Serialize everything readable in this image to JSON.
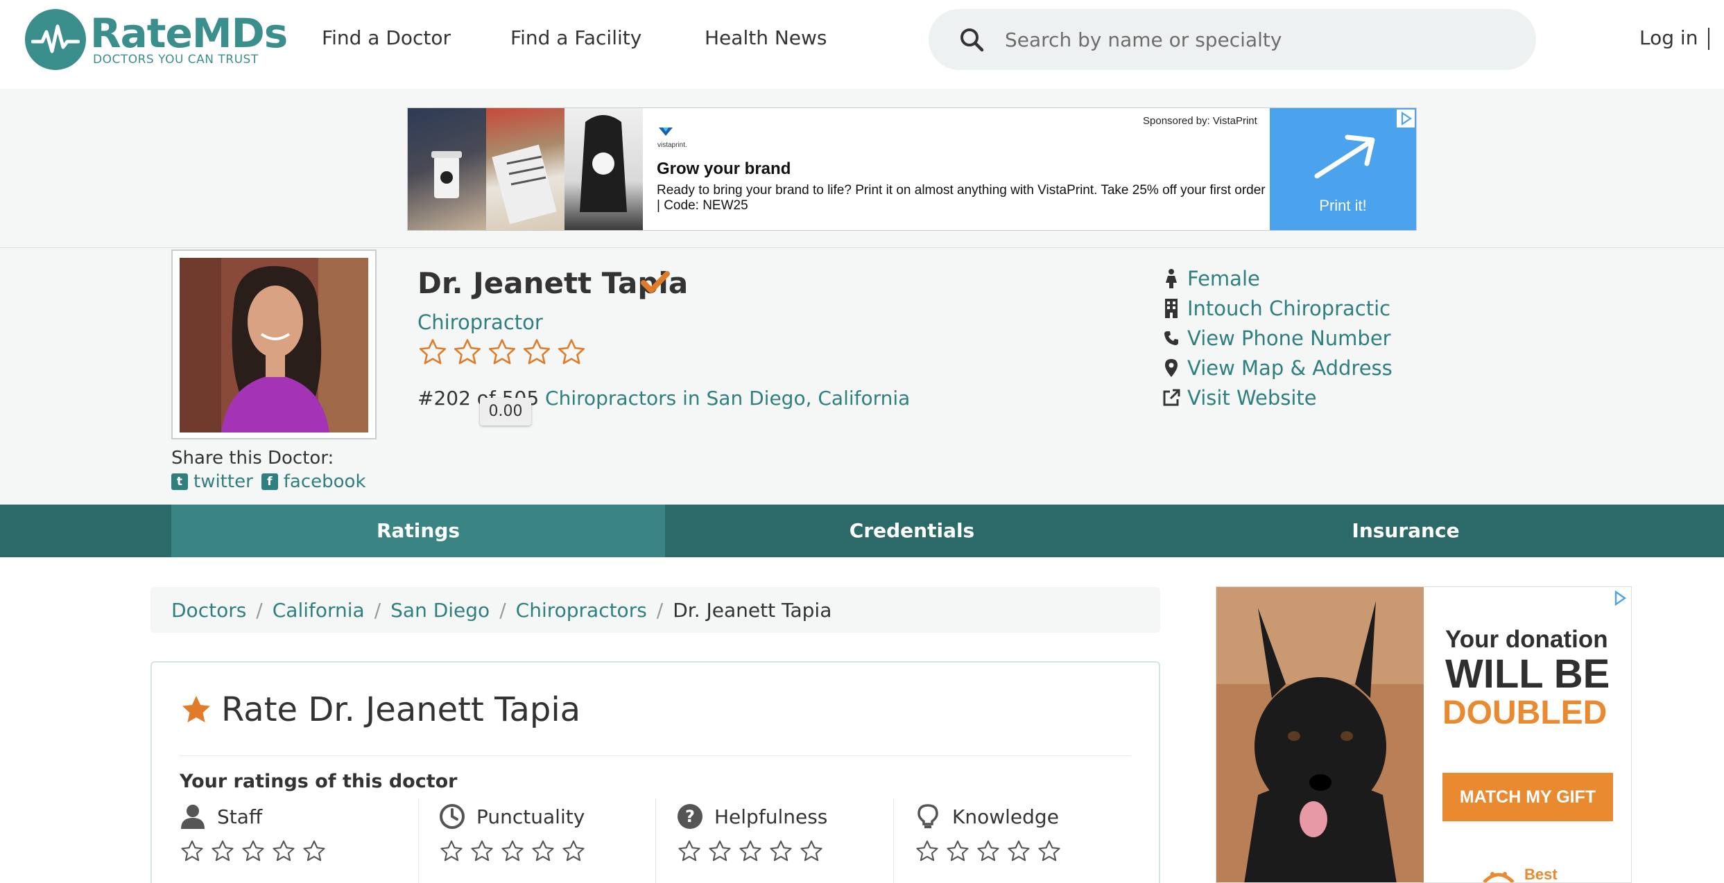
{
  "header": {
    "logo_name": "RateMDs",
    "logo_tagline": "DOCTORS YOU CAN TRUST",
    "nav": [
      "Find a Doctor",
      "Find a Facility",
      "Health News"
    ],
    "search_placeholder": "Search by name or specialty",
    "login": "Log in"
  },
  "top_ad": {
    "sponsor": "Sponsored by: VistaPrint",
    "brand_small": "vistaprint.",
    "title": "Grow your brand",
    "description": "Ready to bring your brand to life? Print it on almost anything with VistaPrint. Take 25% off your first order | Code: NEW25",
    "cta": "Print it!",
    "cta_color": "#4aa3ec"
  },
  "doctor": {
    "name": "Dr. Jeanett Tapia",
    "specialty": "Chiropractor",
    "rating": 0.0,
    "rating_tooltip": "0.00",
    "rank_prefix": "#202 of 505",
    "rank_link": "Chiropractors in San Diego, California",
    "share_label": "Share this Doctor:",
    "share_twitter": "twitter",
    "share_facebook": "facebook",
    "info": [
      {
        "icon": "female-icon",
        "label": "Female"
      },
      {
        "icon": "building-icon",
        "label": "Intouch Chiropractic"
      },
      {
        "icon": "phone-icon",
        "label": "View Phone Number"
      },
      {
        "icon": "map-pin-icon",
        "label": "View Map & Address"
      },
      {
        "icon": "external-link-icon",
        "label": "Visit Website"
      }
    ]
  },
  "tabs": [
    "Ratings",
    "Credentials",
    "Insurance"
  ],
  "breadcrumb": [
    "Doctors",
    "California",
    "San Diego",
    "Chiropractors",
    "Dr. Jeanett Tapia"
  ],
  "rate_card": {
    "title": "Rate Dr. Jeanett Tapia",
    "subtitle": "Your ratings of this doctor",
    "categories": [
      {
        "icon": "person-icon",
        "label": "Staff"
      },
      {
        "icon": "clock-icon",
        "label": "Punctuality"
      },
      {
        "icon": "question-icon",
        "label": "Helpfulness"
      },
      {
        "icon": "lightbulb-icon",
        "label": "Knowledge"
      }
    ]
  },
  "side_ad": {
    "line1": "Your donation",
    "line2": "WILL BE",
    "line3": "DOUBLED",
    "button": "MATCH MY GIFT",
    "footer": "Best",
    "accent": "#e98a31"
  },
  "colors": {
    "brand": "#3a8f8c",
    "link": "#2e7f7d",
    "tab_bar": "#2b6a69",
    "tab_active": "#3a8584",
    "star": "#e07b2a"
  }
}
